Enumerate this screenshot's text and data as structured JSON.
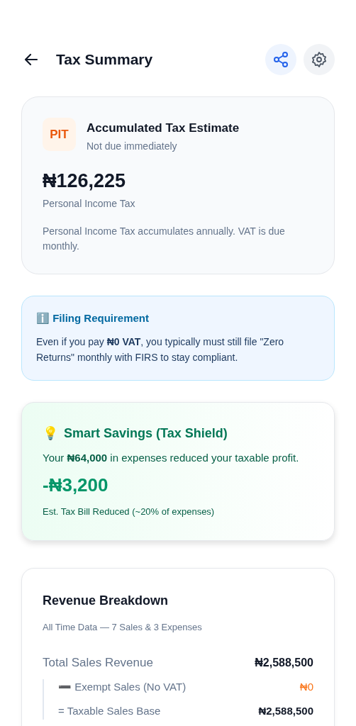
{
  "header": {
    "title": "Tax Summary"
  },
  "estimate": {
    "badge": "PIT",
    "title": "Accumulated Tax Estimate",
    "subtitle": "Not due immediately",
    "amount": "₦126,225",
    "amount_label": "Personal Income Tax",
    "note": "Personal Income Tax accumulates annually. VAT is due monthly."
  },
  "filing": {
    "title": "ℹ️ Filing Requirement",
    "text": "Even if you pay **₦0 VAT**, you typically must still file \"Zero Returns\" monthly with FIRS to stay compliant."
  },
  "savings": {
    "icon": "💡",
    "title": "Smart Savings (Tax Shield)",
    "text": "Your **₦64,000** in expenses reduced your taxable profit.",
    "amount": "-₦3,200",
    "caption": "Est. Tax Bill Reduced (~20% of expenses)"
  },
  "breakdown": {
    "title": "Revenue Breakdown",
    "subtitle": "All Time Data — 7 Sales & 3 Expenses",
    "rows": [
      {
        "kind": "total",
        "label": "Total Sales Revenue",
        "value": "₦2,588,500",
        "color": "#111827"
      },
      {
        "kind": "sub",
        "label": "➖ Exempt Sales (No VAT)",
        "value": "₦0",
        "color": "#f97316"
      },
      {
        "kind": "sub",
        "label": "= Taxable Sales Base",
        "value": "₦2,588,500",
        "color": "#111827"
      }
    ]
  }
}
